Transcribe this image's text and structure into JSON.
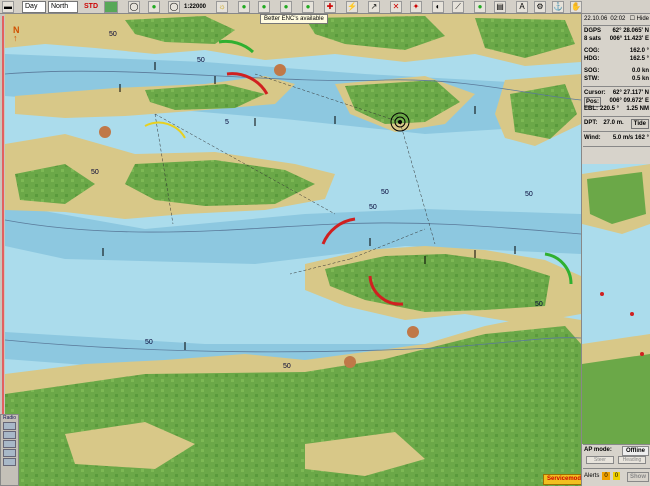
{
  "toolbar": {
    "palette": "Day",
    "orientation": "North",
    "std_label": "STD",
    "scale": "1:22000",
    "hide_label": "Hide"
  },
  "chart": {
    "tooltip": "Better ENC's available",
    "north_label": "N",
    "service_label": "Servicemode",
    "depth_labels": [
      "50",
      "50",
      "50",
      "50",
      "50",
      "50",
      "50",
      "50",
      "50",
      "5"
    ]
  },
  "radio": {
    "label": "Radio"
  },
  "panel": {
    "date": "22.10.06",
    "time": "02:02",
    "hide": "Hide",
    "dgps_label": "DGPS",
    "lat": "62° 28.065' N",
    "sats_label": "8 sats",
    "lon": "006° 11.423' E",
    "cog_label": "COG:",
    "cog": "162.0 °",
    "hdg_label": "HDG:",
    "hdg": "162.5 °",
    "sog_label": "SOG:",
    "sog": "0.0 kn",
    "stw_label": "STW:",
    "stw": "0.5 kn",
    "cursor_label": "Cursor:",
    "cursor_lat": "62° 27.117' N",
    "pos_label": "Pos:",
    "cursor_lon": "006° 09.672' E",
    "ebl_label": "EBL:",
    "ebl": "220.5 °",
    "range": "1.25 NM",
    "dpt_label": "DPT:",
    "dpt": "27.0 m.",
    "tide_label": "Tide",
    "wind_label": "Wind:",
    "wind": "5.0 m/s 162 °",
    "ap_mode_label": "AP mode:",
    "ap_mode": "Offline",
    "steer_label": "Steer",
    "heading_label": "Heading",
    "alerts_label": "Alerts",
    "alert_count_a": "0",
    "alert_count_b": "0",
    "alert_action": "Show"
  },
  "colors": {
    "water": "#abdcec",
    "shallow": "#8dc8e0",
    "land": "#d8c888",
    "vegetation": "#6ba848",
    "toolbar": "#d4d0c8"
  }
}
